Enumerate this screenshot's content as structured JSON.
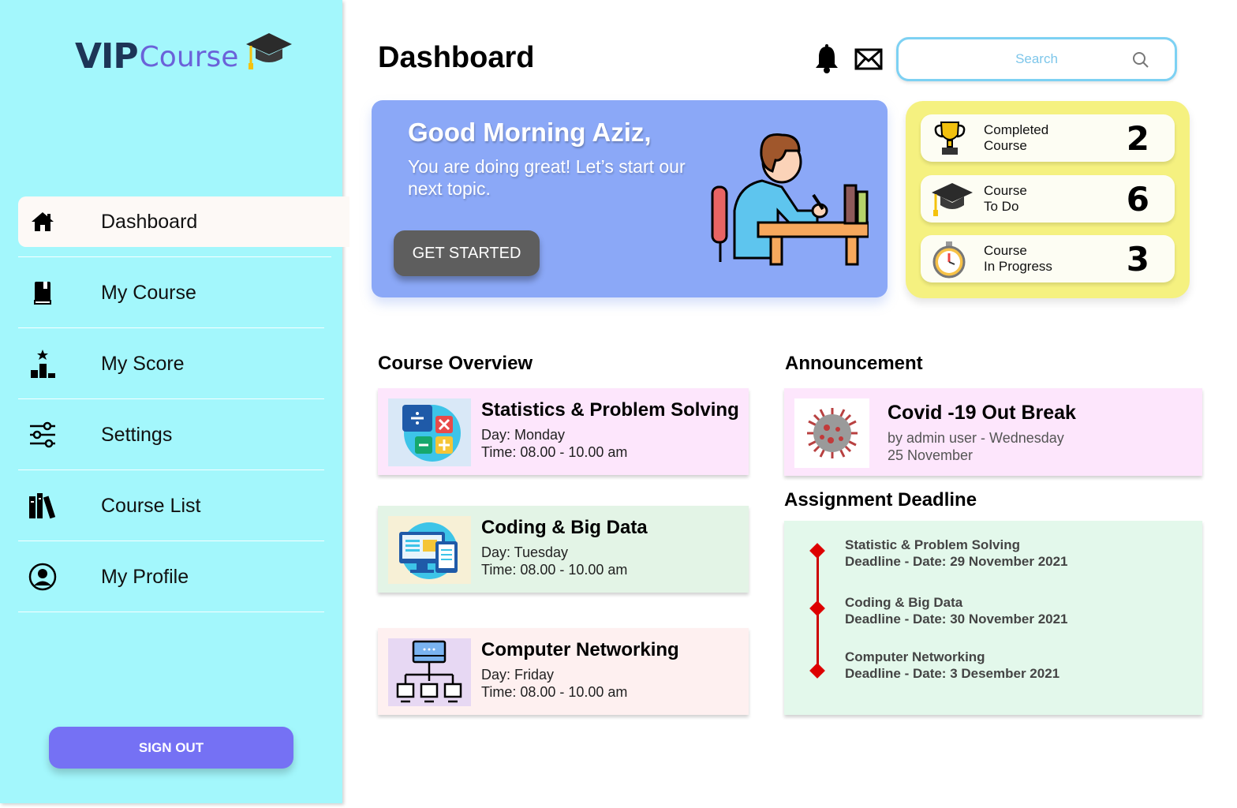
{
  "brand": {
    "part1": "VIP",
    "part2": "Course"
  },
  "sidebar": {
    "items": [
      {
        "label": "Dashboard",
        "icon": "home-icon"
      },
      {
        "label": "My Course",
        "icon": "book-icon"
      },
      {
        "label": "My Score",
        "icon": "podium-icon"
      },
      {
        "label": "Settings",
        "icon": "sliders-icon"
      },
      {
        "label": "Course List",
        "icon": "library-icon"
      },
      {
        "label": "My Profile",
        "icon": "user-circle-icon"
      }
    ],
    "signout_label": "SIGN OUT"
  },
  "header": {
    "title": "Dashboard",
    "search_placeholder": "Search"
  },
  "hero": {
    "greeting": "Good Morning Aziz,",
    "message": "You are doing great! Let’s start our next topic.",
    "button_label": "GET STARTED"
  },
  "stats": [
    {
      "label_line1": "Completed",
      "label_line2": "Course",
      "value": "2",
      "icon": "trophy-icon"
    },
    {
      "label_line1": "Course",
      "label_line2": "To Do",
      "value": "6",
      "icon": "graduation-cap-icon"
    },
    {
      "label_line1": "Course",
      "label_line2": "In Progress",
      "value": "3",
      "icon": "stopwatch-icon"
    }
  ],
  "overview": {
    "title": "Course Overview",
    "courses": [
      {
        "name": "Statistics & Problem Solving",
        "day": "Day: Monday",
        "time": "Time: 08.00 - 10.00 am",
        "bg": "#fde6fc"
      },
      {
        "name": "Coding & Big Data",
        "day": "Day: Tuesday",
        "time": "Time: 08.00 - 10.00 am",
        "bg": "#e3f4e6"
      },
      {
        "name": "Computer Networking",
        "day": "Day: Friday",
        "time": "Time: 08.00 - 10.00 am",
        "bg": "#fef0f0"
      }
    ]
  },
  "announcement": {
    "title": "Announcement",
    "item_title": "Covid -19 Out Break",
    "item_meta_line1": "by admin user - Wednesday",
    "item_meta_line2": "25 November"
  },
  "deadlines": {
    "title": "Assignment Deadline",
    "items": [
      {
        "course": "Statistic & Problem Solving",
        "deadline": "Deadline - Date: 29 November 2021"
      },
      {
        "course": "Coding & Big Data",
        "deadline": "Deadline - Date: 30 November 2021"
      },
      {
        "course": "Computer Networking",
        "deadline": "Deadline - Date: 3 Desember 2021"
      }
    ]
  },
  "colors": {
    "sidebar_bg": "#a3f7fc",
    "accent": "#7571f4",
    "hero_bg": "#8ba8f7",
    "stats_bg": "#f5f180",
    "deadline_marker": "#dd0000"
  }
}
